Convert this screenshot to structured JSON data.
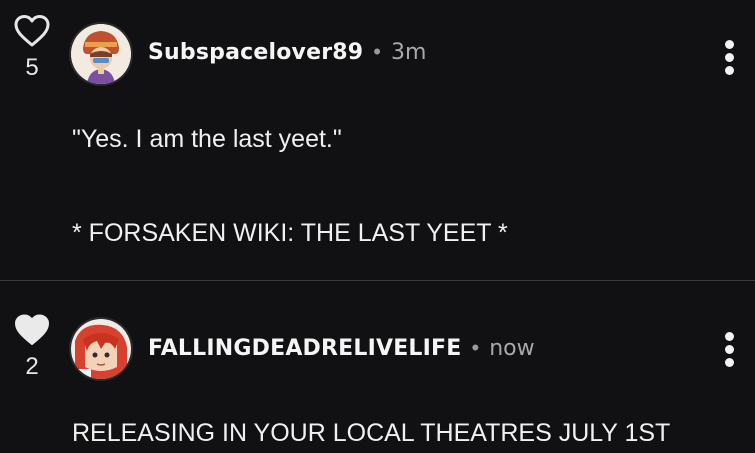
{
  "comments": [
    {
      "likes": "5",
      "liked": false,
      "username": "Subspacelover89",
      "separator": "•",
      "time": "3m",
      "lines": [
        "\"Yes. I am the last yeet.\"",
        "* FORSAKEN WIKI: THE LAST YEET *"
      ]
    },
    {
      "likes": "2",
      "liked": true,
      "username": "FALLINGDEADRELIVELIFE",
      "separator": "•",
      "time": "now",
      "lines": [
        "RELEASING IN YOUR LOCAL THEATRES JULY 1ST"
      ]
    }
  ],
  "icons": {
    "like_outline": "heart-outline-icon",
    "like_filled": "heart-filled-icon",
    "menu": "more-vertical-icon"
  },
  "colors": {
    "background": "#111113",
    "text": "#f2f2f2",
    "muted": "#a8a8ad",
    "divider": "#3a3a3e"
  }
}
